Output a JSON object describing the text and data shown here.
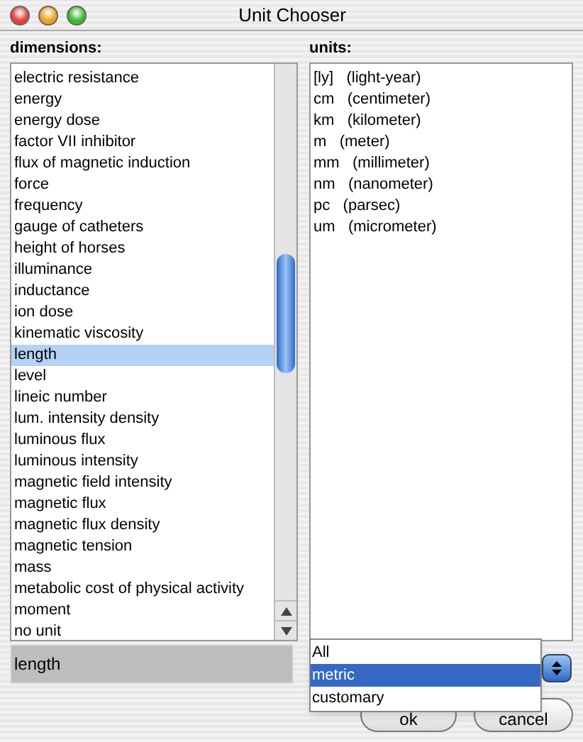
{
  "window": {
    "title": "Unit Chooser"
  },
  "dimensions": {
    "label": "dimensions:",
    "items": [
      {
        "text": "electric resistance",
        "selected": false
      },
      {
        "text": "energy",
        "selected": false
      },
      {
        "text": "energy dose",
        "selected": false
      },
      {
        "text": "factor VII inhibitor",
        "selected": false
      },
      {
        "text": "flux of magnetic induction",
        "selected": false
      },
      {
        "text": "force",
        "selected": false
      },
      {
        "text": "frequency",
        "selected": false
      },
      {
        "text": "gauge of catheters",
        "selected": false
      },
      {
        "text": "height of horses",
        "selected": false
      },
      {
        "text": "illuminance",
        "selected": false
      },
      {
        "text": "inductance",
        "selected": false
      },
      {
        "text": "ion dose",
        "selected": false
      },
      {
        "text": "kinematic viscosity",
        "selected": false
      },
      {
        "text": "length",
        "selected": true
      },
      {
        "text": "level",
        "selected": false
      },
      {
        "text": "lineic number",
        "selected": false
      },
      {
        "text": "lum. intensity density",
        "selected": false
      },
      {
        "text": "luminous flux",
        "selected": false
      },
      {
        "text": "luminous intensity",
        "selected": false
      },
      {
        "text": "magnetic field intensity",
        "selected": false
      },
      {
        "text": "magnetic flux",
        "selected": false
      },
      {
        "text": "magnetic flux density",
        "selected": false
      },
      {
        "text": "magnetic tension",
        "selected": false
      },
      {
        "text": "mass",
        "selected": false
      },
      {
        "text": "metabolic cost of physical activity",
        "selected": false
      },
      {
        "text": "moment",
        "selected": false
      },
      {
        "text": "no unit",
        "selected": false
      }
    ]
  },
  "units": {
    "label": "units:",
    "items": [
      "[ly]   (light-year)",
      "cm   (centimeter)",
      "km   (kilometer)",
      "m   (meter)",
      "mm   (millimeter)",
      "nm   (nanometer)",
      "pc   (parsec)",
      "um   (micrometer)"
    ]
  },
  "selection_field": {
    "value": "length"
  },
  "system_menu": {
    "options": [
      {
        "text": "All",
        "selected": false
      },
      {
        "text": "metric",
        "selected": true
      },
      {
        "text": "customary",
        "selected": false
      }
    ]
  },
  "buttons": [
    "ok",
    "cancel"
  ]
}
